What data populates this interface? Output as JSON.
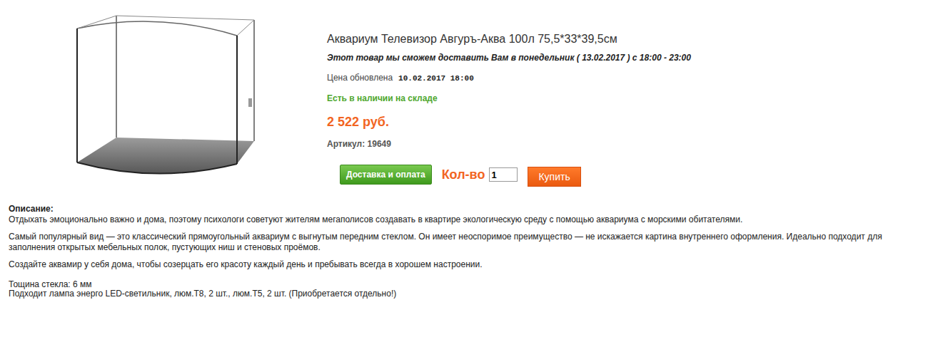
{
  "product": {
    "title": "Аквариум Телевизор Авгуръ-Аква 100л 75,5*33*39,5см",
    "delivery": "Этот товар мы сможем доставить Вам в понедельник ( 13.02.2017 ) с 18:00 - 23:00",
    "price_updated_label": "Цена обновлена",
    "price_updated": "10.02.2017 18:00",
    "stock": "Есть в наличии на складе",
    "price": "2 522 руб.",
    "sku": "Артикул: 19649"
  },
  "actions": {
    "delivery_button": "Доставка и оплата",
    "quantity_label": "Кол-во",
    "quantity": "1",
    "buy_button": "Купить"
  },
  "description": {
    "heading": "Описание:",
    "paragraphs": [
      "Отдыхать эмоционально важно и дома, поэтому психологи советуют жителям мегаполисов создавать в квартире экологическую среду с помощью аквариума с морскими обитателями.",
      "Самый популярный вид — это классический прямоугольный аквариум с выгнутым передним стеклом. Он имеет неоспоримое преимущество — не искажается картина внутреннего оформления. Идеально подходит для заполнения открытых мебельных полок, пустующих ниш и стеновых проёмов.",
      "Создайте аквамир у себя дома, чтобы созерцать его красоту каждый день и пребывать всегда в хорошем настроении."
    ],
    "specs": [
      "Тощина стекла: 6 мм",
      "Подходит лампа энерго LED-светильник, люм.T8, 2 шт., люм.T5, 2 шт. (Приобретается отдельно!)"
    ]
  }
}
